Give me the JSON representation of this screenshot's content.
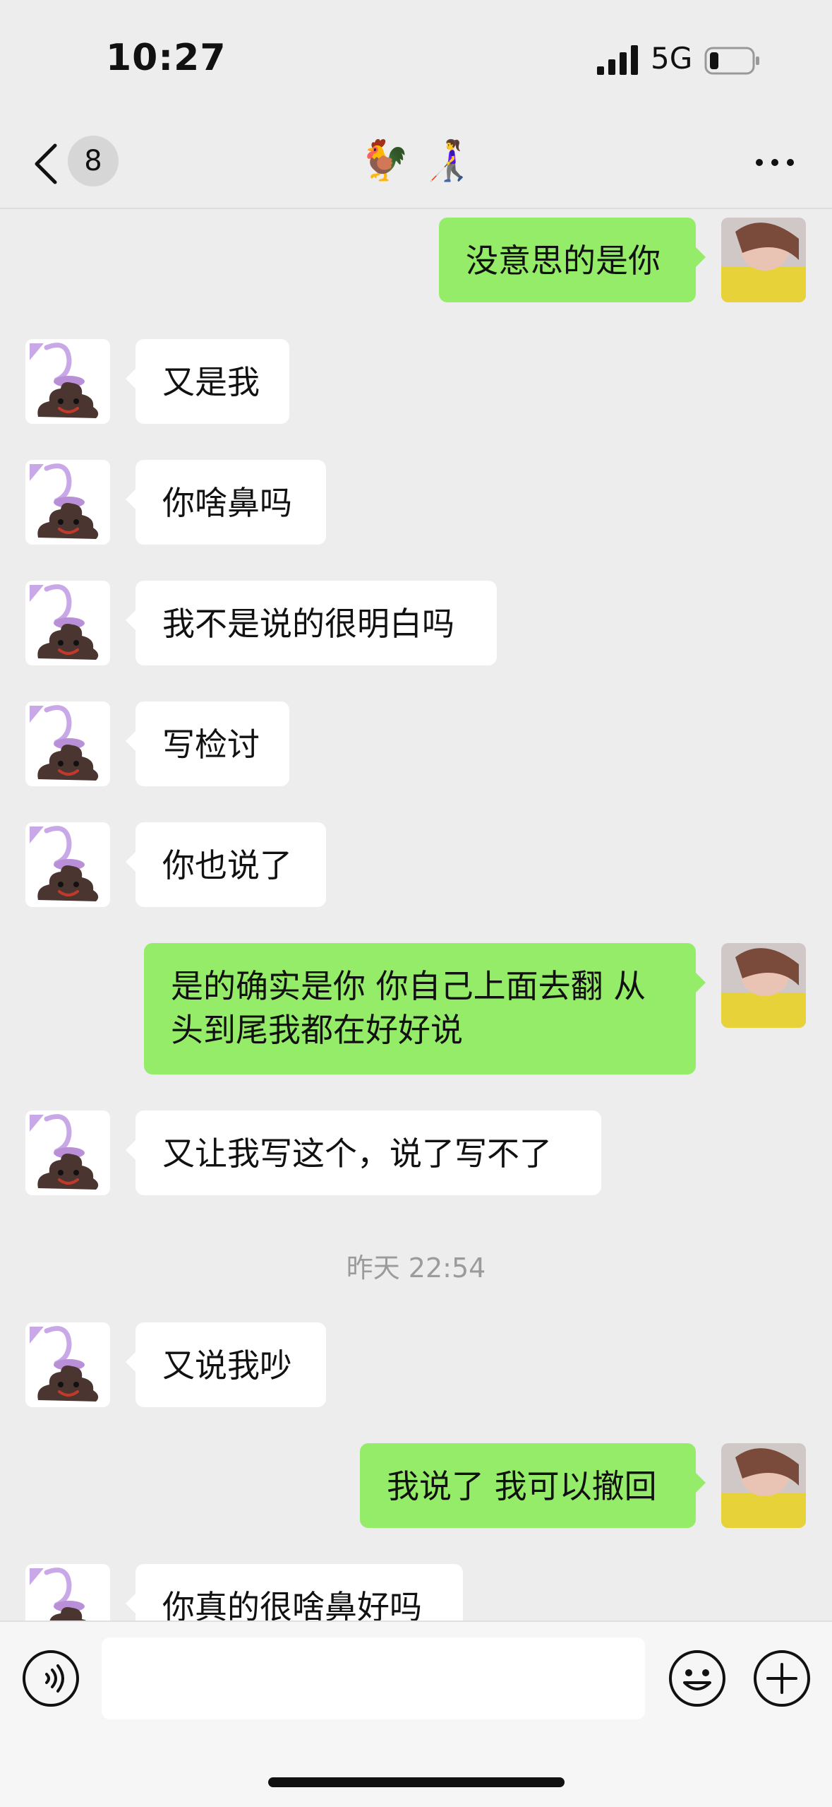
{
  "status_bar": {
    "time": "10:27",
    "network": "5G"
  },
  "nav": {
    "unread_count": "8",
    "title": "🐓 👩‍🦯"
  },
  "timestamp": "昨天 22:54",
  "messages": [
    {
      "side": "out",
      "text": "没意思的是你"
    },
    {
      "side": "in",
      "text": "又是我"
    },
    {
      "side": "in",
      "text": "你啥鼻吗"
    },
    {
      "side": "in",
      "text": "我不是说的很明白吗"
    },
    {
      "side": "in",
      "text": "写检讨"
    },
    {
      "side": "in",
      "text": "你也说了"
    },
    {
      "side": "out",
      "text": "是的确实是你 你自己上面去翻 从头到尾我都在好好说"
    },
    {
      "side": "in",
      "text": "又让我写这个，说了写不了"
    },
    {
      "side": "in",
      "text": "又说我吵"
    },
    {
      "side": "out",
      "text": "我说了 我可以撤回"
    },
    {
      "side": "in",
      "text": "你真的很啥鼻好吗"
    }
  ],
  "icons": {
    "back": "chevron-left-icon",
    "more": "more-dots-icon",
    "voice": "voice-icon",
    "emoji": "emoji-icon",
    "plus": "plus-icon"
  },
  "colors": {
    "background": "#ededed",
    "outgoing_bubble": "#95ec69",
    "incoming_bubble": "#ffffff",
    "timestamp_text": "#9b9b9b"
  }
}
